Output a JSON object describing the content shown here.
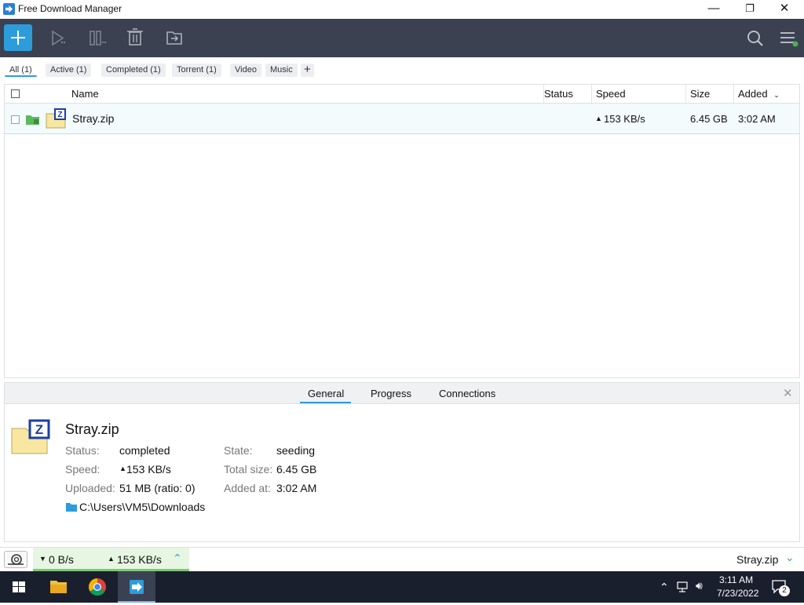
{
  "app": {
    "title": "Free Download Manager"
  },
  "window_controls": {
    "minimize": "—",
    "restore": "❐",
    "close": "✕"
  },
  "filters": [
    {
      "label": "All (1)"
    },
    {
      "label": "Active (1)"
    },
    {
      "label": "Completed (1)"
    },
    {
      "label": "Torrent (1)"
    },
    {
      "label": "Video"
    },
    {
      "label": "Music"
    }
  ],
  "table": {
    "headers": {
      "name": "Name",
      "status": "Status",
      "speed": "Speed",
      "size": "Size",
      "added": "Added"
    },
    "rows": [
      {
        "name": "Stray.zip",
        "status": "",
        "speed": "153 KB/s",
        "size": "6.45 GB",
        "added": "3:02 AM"
      }
    ]
  },
  "details": {
    "tabs": [
      "General",
      "Progress",
      "Connections"
    ],
    "active_tab": "General",
    "filename": "Stray.zip",
    "status_label": "Status:",
    "status_value": "completed",
    "speed_label": "Speed:",
    "speed_value": "153 KB/s",
    "uploaded_label": "Uploaded:",
    "uploaded_value": "51 MB (ratio: 0)",
    "state_label": "State:",
    "state_value": "seeding",
    "total_size_label": "Total size:",
    "total_size_value": "6.45 GB",
    "added_at_label": "Added at:",
    "added_at_value": "3:02 AM",
    "path": "C:\\Users\\VM5\\Downloads"
  },
  "statusbar": {
    "down_speed": "0 B/s",
    "up_speed": "153 KB/s",
    "current_file": "Stray.zip"
  },
  "taskbar": {
    "time": "3:11 AM",
    "date": "7/23/2022",
    "notifications": "2"
  },
  "colors": {
    "accent": "#2d9cdb",
    "toolbar": "#3b4150",
    "taskbar": "#1a1f2e",
    "green": "#4caf50"
  }
}
